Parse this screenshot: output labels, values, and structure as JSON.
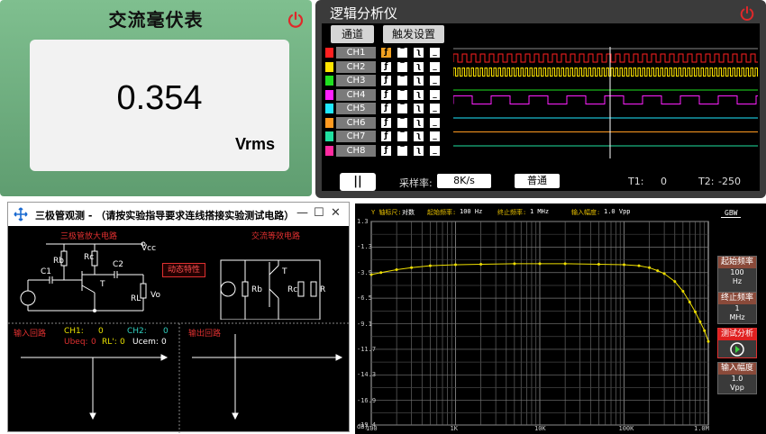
{
  "millivoltmeter": {
    "title": "交流毫伏表",
    "value": "0.354",
    "unit": "Vrms",
    "power_icon": "power-icon",
    "power_color": "#e0282a"
  },
  "logic_analyzer": {
    "title": "逻辑分析仪",
    "tabs": [
      "通道",
      "触发设置"
    ],
    "channels": [
      {
        "label": "CH1",
        "color": "#ff2020"
      },
      {
        "label": "CH2",
        "color": "#ffe400"
      },
      {
        "label": "CH3",
        "color": "#20e020"
      },
      {
        "label": "CH4",
        "color": "#ff20ff"
      },
      {
        "label": "CH5",
        "color": "#20e8ff"
      },
      {
        "label": "CH6",
        "color": "#ff9a20"
      },
      {
        "label": "CH7",
        "color": "#20e0a0"
      },
      {
        "label": "CH8",
        "color": "#ff2aa0"
      }
    ],
    "trigger_glyphs": [
      "ƒ",
      "‾",
      "ʅ",
      "_"
    ],
    "pause_label": "||",
    "sample_rate_label": "采样率:",
    "sample_rate_value": "8K/s",
    "mode_value": "普通",
    "t1_label": "T1:",
    "t1_value": "0",
    "t2_label": "T2:",
    "t2_value": "-250"
  },
  "transistor_window": {
    "title": "三极管观测 - （请按实验指导要求连线搭接实验测试电路）",
    "controls": [
      "—",
      "☐",
      "✕"
    ],
    "circuit_title": "三极管放大电路",
    "equiv_title": "交流等效电路",
    "dynamic_button": "动态特性",
    "labels": {
      "vcc": "Vcc",
      "rb": "Rb",
      "rc": "Rc",
      "c1": "C1",
      "c2": "C2",
      "t": "T",
      "rl": "RL",
      "vo": "Vo",
      "rb2": "Rb",
      "rc2": "Rc",
      "r": "R",
      "t2": "T"
    },
    "input_loop": "输入回路",
    "output_loop": "输出回路",
    "ch1_label": "CH1:",
    "ch1_value": "0",
    "ch2_label": "CH2:",
    "ch2_value": "0",
    "ubeq_label": "Ubeq:",
    "ubeq_value": "0",
    "rl_label": "RL':",
    "rl_value": "0",
    "ucem_label": "Ucem:",
    "ucem_value": "0"
  },
  "bode_plotter": {
    "header": [
      {
        "label": "Y 轴标尺:",
        "value": "对数"
      },
      {
        "label": "起始频率:",
        "value": "100 Hz"
      },
      {
        "label": "终止频率:",
        "value": "1 MHz"
      },
      {
        "label": "输入幅度:",
        "value": "1.0 Vpp"
      }
    ],
    "gbw_label": "GBW",
    "knobs": [
      {
        "label": "起始频率",
        "value": "100",
        "unit": "Hz"
      },
      {
        "label": "终止频率",
        "value": "1",
        "unit": "MHz"
      },
      {
        "label": "测试分析",
        "value": "",
        "unit": ""
      },
      {
        "label": "输入幅度",
        "value": "1.0",
        "unit": "Vpp"
      }
    ],
    "y_ticks": [
      "1.3",
      "-1.3",
      "-3.9",
      "-6.5",
      "-9.1",
      "-11.7",
      "-14.3",
      "-16.9",
      "-19.4"
    ],
    "y_unit": "dB)",
    "x_ticks": [
      "100",
      "1K",
      "10K",
      "100K",
      "1.0M"
    ]
  },
  "chart_data": {
    "type": "scatter",
    "title": "",
    "xlabel": "",
    "ylabel": "",
    "x_scale": "log",
    "xlim": [
      100,
      1000000
    ],
    "ylim": [
      -19.4,
      1.3
    ],
    "series": [
      {
        "color": "#f0e000",
        "x": [
          100,
          130,
          200,
          300,
          500,
          1000,
          2000,
          5000,
          10000,
          20000,
          50000,
          100000,
          150000,
          200000,
          250000,
          300000,
          400000,
          500000,
          600000,
          700000,
          800000,
          900000,
          1000000
        ],
        "y": [
          -4.1,
          -3.9,
          -3.6,
          -3.4,
          -3.2,
          -3.1,
          -3.05,
          -3.0,
          -3.0,
          -3.0,
          -3.05,
          -3.1,
          -3.2,
          -3.4,
          -3.7,
          -4.0,
          -4.8,
          -5.8,
          -6.9,
          -7.9,
          -8.9,
          -9.8,
          -10.9
        ]
      }
    ],
    "grid": true
  }
}
